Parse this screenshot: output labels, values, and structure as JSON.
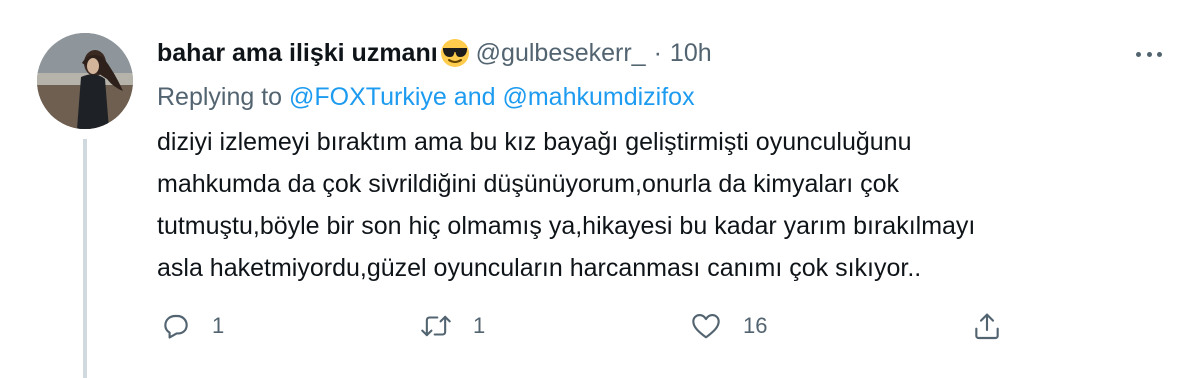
{
  "tweet": {
    "display_name": "bahar ama ilişki uzmanı",
    "display_name_emoji": "smiling-face-with-sunglasses-icon",
    "handle": "@gulbesekerr_",
    "separator": "·",
    "time": "10h",
    "replying_prefix": "Replying to",
    "replying_user_1": "@FOXTurkiye",
    "replying_and": "and",
    "replying_user_2": "@mahkumdizifox",
    "body_lines": [
      "diziyi izlemeyi bıraktım ama bu kız bayağı geliştirmişti oyunculuğunu",
      "mahkumda da çok sivrildiğini düşünüyorum,onurla da kimyaları çok",
      "tutmuştu,böyle bir son hiç olmamış ya,hikayesi bu kadar yarım bırakılmayı",
      "asla haketmiyordu,güzel oyuncuların harcanması canımı çok sıkıyor.."
    ],
    "actions": {
      "reply_count": "1",
      "retweet_count": "1",
      "like_count": "16",
      "reply_icon": "reply-icon",
      "retweet_icon": "retweet-icon",
      "like_icon": "heart-icon",
      "share_icon": "share-icon"
    }
  },
  "colors": {
    "text_primary": "#0f1419",
    "text_secondary": "#536471",
    "link": "#1d9bf0",
    "thread_line": "#cfd9de"
  }
}
